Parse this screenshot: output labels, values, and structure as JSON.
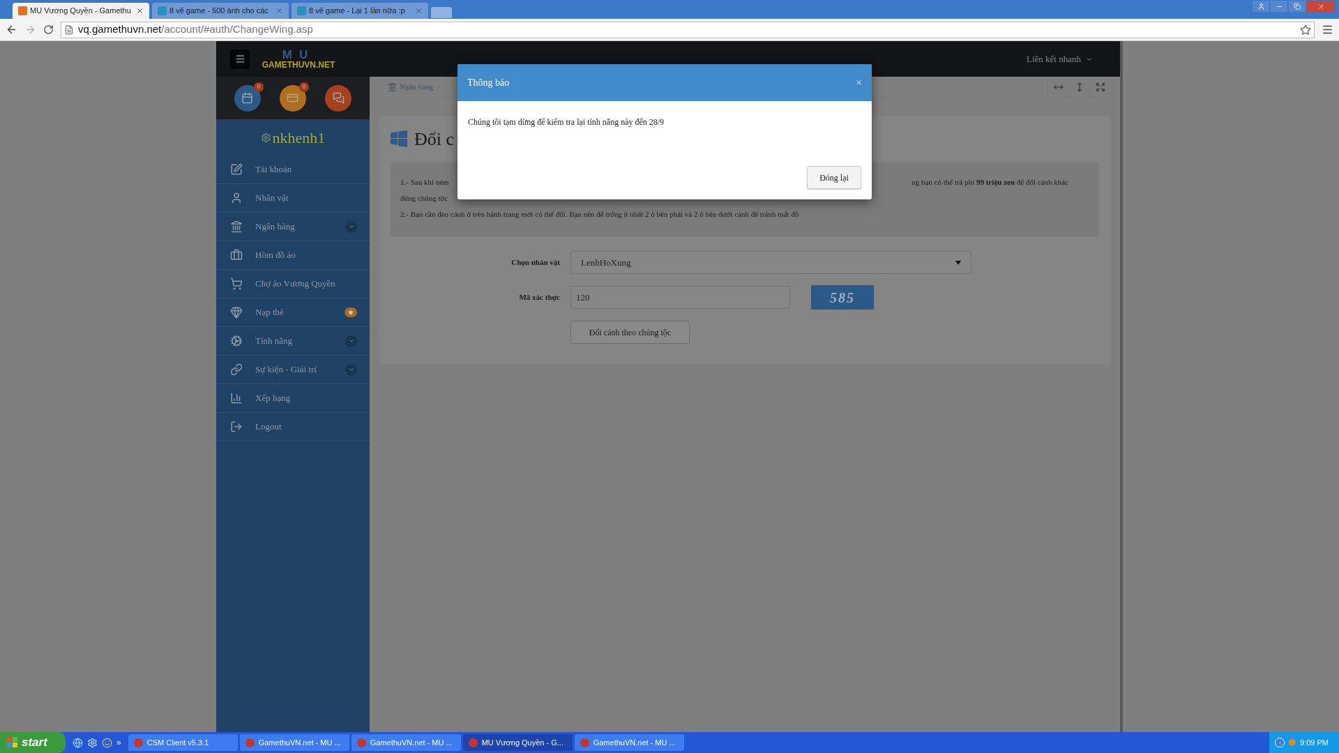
{
  "browser": {
    "tabs": [
      {
        "title": "MU Vương Quyền - Gamethu",
        "selected": true
      },
      {
        "title": "8 vẽ game - 500 ảnh cho các",
        "selected": false
      },
      {
        "title": "8 vẽ game - Lại 1 lần nữa :p",
        "selected": false
      }
    ],
    "address": {
      "host": "vq.gamethuvn.net",
      "path": "/account/#auth/ChangeWing.asp"
    }
  },
  "header": {
    "logo": {
      "back": "MU",
      "front": "GAMETHUVN.NET"
    },
    "quick_links": "Liên kết nhanh"
  },
  "sidebar": {
    "shortcuts": [
      {
        "kind": "calendar",
        "color": "#2a5a86",
        "badge": "0"
      },
      {
        "kind": "card",
        "color": "#b06f1c",
        "badge": "0"
      },
      {
        "kind": "chat",
        "color": "#a6401f"
      }
    ],
    "username": "nkhenh1",
    "items": [
      {
        "label": "Tài khoản",
        "kind": "plain"
      },
      {
        "label": "Nhân vật",
        "kind": "plain"
      },
      {
        "label": "Ngân hàng",
        "kind": "expand"
      },
      {
        "label": "Hòm đồ ảo",
        "kind": "plain"
      },
      {
        "label": "Chợ ảo Vương Quyền",
        "kind": "plain"
      },
      {
        "label": "Nạp thẻ",
        "kind": "star"
      },
      {
        "label": "Tính năng",
        "kind": "expand"
      },
      {
        "label": "Sự kiện - Giải trí",
        "kind": "expand"
      },
      {
        "label": "Xếp hạng",
        "kind": "plain"
      },
      {
        "label": "Logout",
        "kind": "plain"
      }
    ]
  },
  "breadcrumb": {
    "items": [
      "Ngân hàng"
    ],
    "separator": "/"
  },
  "page": {
    "title": "Đổi c",
    "info": {
      "line1_start": "1.- Sau khi ném",
      "line1_end": "ng bạn có thể trả phí **99 triệu zen** để đổi cánh khác",
      "line1_wrap": "đúng chủng tộc",
      "line2": "2.- Bạn cần đeo cánh ở trên hành trang mới có thể đổi. Bạn nên để trống ít nhất 2 ô bên phải và 2 ô bên dưới cánh để tránh mất đồ"
    },
    "form": {
      "character_label": "Chọn nhân vật",
      "character_value": "LenhHoXung",
      "captcha_label": "Mã xác thực",
      "captcha_value": "120",
      "captcha_image": "585",
      "submit": "Đổi cánh theo chủng tộc"
    }
  },
  "modal": {
    "title": "Thông báo",
    "close": "×",
    "message": "Chúng tôi tạm dừng để kiểm tra lại tính năng này đến 28/9",
    "button": "Đóng lại"
  },
  "taskbar": {
    "start": "start",
    "more": "»",
    "tasks": [
      {
        "label": "CSM Client v5.3.1",
        "selected": false
      },
      {
        "label": "GamethuVN.net - MU ...",
        "selected": false
      },
      {
        "label": "GamethuVN.net - MU ...",
        "selected": false
      },
      {
        "label": "MU Vương Quyền - G...",
        "selected": true
      },
      {
        "label": "GamethuVN.net - MU ...",
        "selected": false
      }
    ],
    "time": "9:09 PM"
  }
}
